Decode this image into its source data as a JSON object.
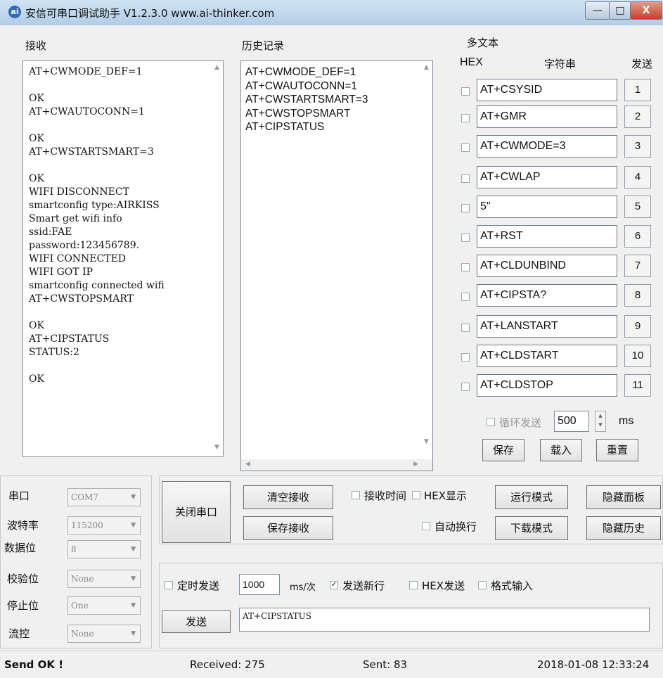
{
  "window": {
    "title": "安信可串口调试助手 V1.2.3.0    www.ai-thinker.com",
    "app_icon": "ai-icon",
    "minimize": "—",
    "maximize": "□",
    "close": "X"
  },
  "receive": {
    "label": "接收",
    "text": "AT+CWMODE_DEF=1\n\nOK\nAT+CWAUTOCONN=1\n\nOK\nAT+CWSTARTSMART=3\n\nOK\nWIFI DISCONNECT\nsmartconfig type:AIRKISS\nSmart get wifi info\nssid:FAE\npassword:123456789.\nWIFI CONNECTED\nWIFI GOT IP\nsmartconfig connected wifi\nAT+CWSTOPSMART\n\nOK\nAT+CIPSTATUS\nSTATUS:2\n\nOK"
  },
  "history": {
    "label": "历史记录",
    "text": "AT+CWMODE_DEF=1\nAT+CWAUTOCONN=1\nAT+CWSTARTSMART=3\nAT+CWSTOPSMART\nAT+CIPSTATUS"
  },
  "multitext": {
    "label": "多文本",
    "col_hex": "HEX",
    "col_string": "字符串",
    "col_send": "发送",
    "rows": [
      {
        "value": "AT+CSYSID",
        "send": "1"
      },
      {
        "value": "AT+GMR",
        "send": "2"
      },
      {
        "value": "AT+CWMODE=3",
        "send": "3"
      },
      {
        "value": "AT+CWLAP",
        "send": "4"
      },
      {
        "value": "5\"",
        "send": "5"
      },
      {
        "value": "AT+RST",
        "send": "6"
      },
      {
        "value": "AT+CLDUNBIND",
        "send": "7"
      },
      {
        "value": "AT+CIPSTA?",
        "send": "8"
      },
      {
        "value": "AT+LANSTART",
        "send": "9"
      },
      {
        "value": "AT+CLDSTART",
        "send": "10"
      },
      {
        "value": "AT+CLDSTOP",
        "send": "11"
      }
    ],
    "loop_label": "循环发送",
    "loop_value": "500",
    "loop_unit": "ms",
    "save": "保存",
    "load": "载入",
    "reset": "重置"
  },
  "serial": {
    "port_label": "串口",
    "port_value": "COM7",
    "baud_label": "波特率",
    "baud_value": "115200",
    "data_label": "数据位",
    "data_value": "8",
    "parity_label": "校验位",
    "parity_value": "None",
    "stop_label": "停止位",
    "stop_value": "One",
    "flow_label": "流控",
    "flow_value": "None"
  },
  "controls": {
    "close_port": "关闭串口",
    "clear_recv": "清空接收",
    "save_recv": "保存接收",
    "recv_time": "接收时间",
    "hex_display": "HEX显示",
    "auto_wrap": "自动换行",
    "run_mode": "运行模式",
    "download_mode": "下载模式",
    "hide_panel": "隐藏面板",
    "hide_history": "隐藏历史",
    "timed_send": "定时发送",
    "timed_value": "1000",
    "timed_unit": "ms/次",
    "send_newline": "发送新行",
    "hex_send": "HEX发送",
    "format_input": "格式输入",
    "send": "发送",
    "send_text": "AT+CIPSTATUS"
  },
  "status": {
    "message": "Send OK !",
    "received": "Received: 275",
    "sent": "Sent: 83",
    "datetime": "2018-01-08 12:33:24"
  }
}
